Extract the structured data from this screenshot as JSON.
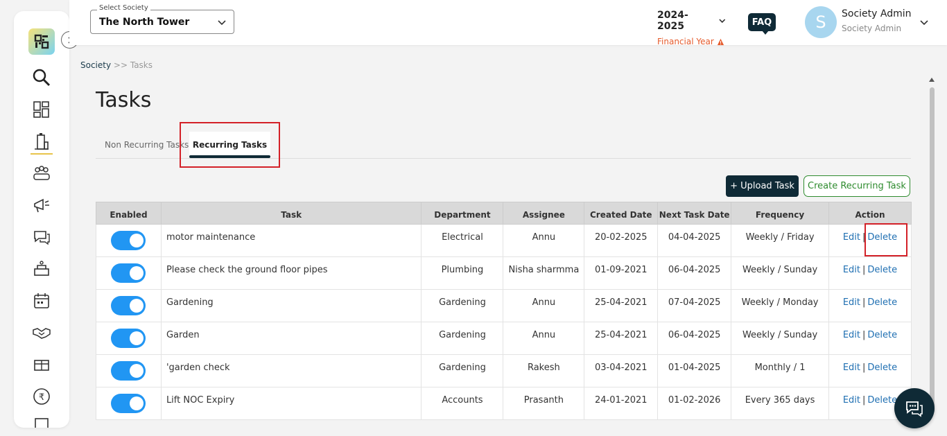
{
  "header": {
    "society_label": "Select Society",
    "society_value": "The North Tower",
    "year": "2024-2025",
    "financial_year_label": "Financial Year",
    "faq": "FAQ",
    "avatar_letter": "S",
    "user_name": "Society Admin",
    "user_role": "Society Admin"
  },
  "breadcrumb": {
    "root": "Society",
    "separator": ">>",
    "current": "Tasks"
  },
  "page_title": "Tasks",
  "tabs": {
    "non_recurring": "Non Recurring Tasks",
    "recurring": "Recurring Tasks"
  },
  "buttons": {
    "upload": "+ Upload Task",
    "create": "Create Recurring Task"
  },
  "table": {
    "headers": [
      "Enabled",
      "Task",
      "Department",
      "Assignee",
      "Created Date",
      "Next Task Date",
      "Frequency",
      "Action"
    ],
    "rows": [
      {
        "task": "motor maintenance",
        "department": "Electrical",
        "assignee": "Annu",
        "created": "20-02-2025",
        "next": "04-04-2025",
        "frequency": "Weekly / Friday"
      },
      {
        "task": "Please check the ground floor pipes",
        "department": "Plumbing",
        "assignee": "Nisha sharmma",
        "created": "01-09-2021",
        "next": "06-04-2025",
        "frequency": "Weekly / Sunday"
      },
      {
        "task": "Gardening",
        "department": "Gardening",
        "assignee": "Annu",
        "created": "25-04-2021",
        "next": "07-04-2025",
        "frequency": "Weekly / Monday"
      },
      {
        "task": "Garden",
        "department": "Gardening",
        "assignee": "Annu",
        "created": "25-04-2021",
        "next": "06-04-2025",
        "frequency": "Weekly / Sunday"
      },
      {
        "task": "'garden check",
        "department": "Gardening",
        "assignee": "Rakesh",
        "created": "03-04-2021",
        "next": "01-04-2025",
        "frequency": "Monthly / 1"
      },
      {
        "task": "Lift NOC Expiry",
        "department": "Accounts",
        "assignee": "Prasanth",
        "created": "24-01-2021",
        "next": "01-02-2026",
        "frequency": "Every 365 days"
      }
    ],
    "action_edit": "Edit",
    "action_sep": "|",
    "action_delete": "Delete"
  },
  "colors": {
    "brand_dark": "#0f2a36",
    "toggle": "#2196f3",
    "link": "#1f6fb2",
    "highlight": "#d32027",
    "warning": "#e55a2b"
  }
}
